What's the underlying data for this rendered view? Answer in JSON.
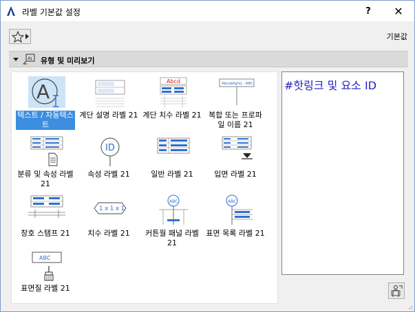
{
  "window": {
    "title": "라벨 기본값 설정",
    "help_label": "?",
    "close_label": "✕"
  },
  "toolbar": {
    "default_label": "기본값"
  },
  "section": {
    "title": "유형 및 미리보기"
  },
  "library": {
    "items": [
      {
        "label": "텍스트 / 자동텍스트",
        "icon": "text-autotext-icon",
        "selected": true
      },
      {
        "label": "계단 설명 라벨 21",
        "icon": "stair-description-label-icon"
      },
      {
        "label": "계단 치수 라벨 21",
        "icon": "stair-dimension-label-icon"
      },
      {
        "label": "복합 또는 프로파일 이름 21",
        "icon": "composite-profile-name-icon"
      },
      {
        "label": "분류 및 속성 라벨 21",
        "icon": "classification-property-label-icon"
      },
      {
        "label": "속성 라벨 21",
        "icon": "property-label-icon"
      },
      {
        "label": "일반 라벨 21",
        "icon": "general-label-icon"
      },
      {
        "label": "입면 라벨 21",
        "icon": "elevation-label-icon"
      },
      {
        "label": "창호 스탬프 21",
        "icon": "window-door-stamp-icon"
      },
      {
        "label": "치수 라벨 21",
        "icon": "dimension-label-icon"
      },
      {
        "label": "커튼월 패널 라벨 21",
        "icon": "curtain-wall-panel-label-icon"
      },
      {
        "label": "표면 목록 라벨 21",
        "icon": "surface-list-label-icon"
      },
      {
        "label": "표면질 라벨 21",
        "icon": "surface-label-icon"
      }
    ],
    "thumb_texts": {
      "abcd": "Abcd",
      "abc": "ABC",
      "id": "ID",
      "dim": "1 x 1 x 1",
      "profile": "Abcdefghij - ABC"
    }
  },
  "preview": {
    "text": "#핫링크 및 요소 ID"
  },
  "colors": {
    "accent": "#3d8ee0",
    "selected_bg": "#cce4f7",
    "preview_text": "#1f1fc8",
    "thumb_blue": "#2f6fd0"
  }
}
